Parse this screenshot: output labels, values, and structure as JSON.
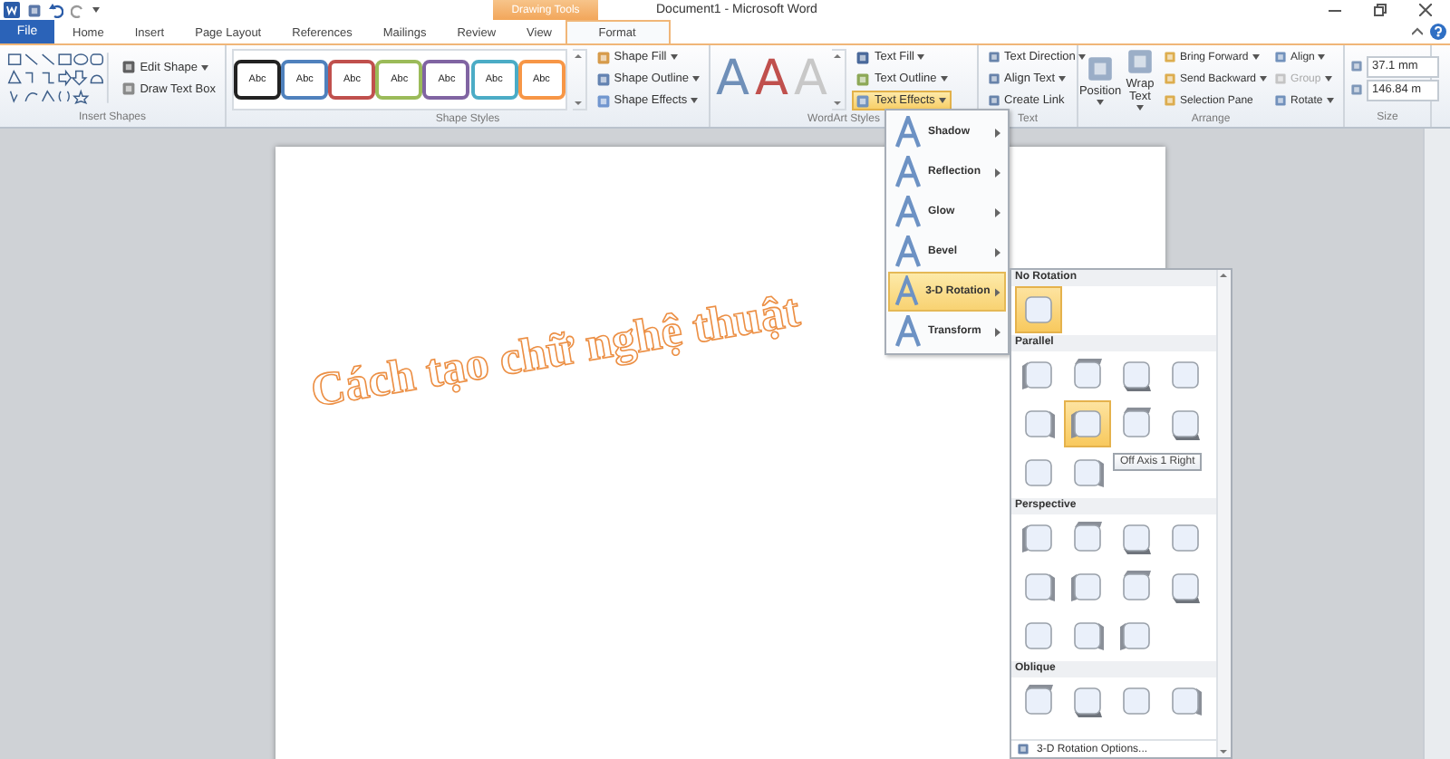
{
  "title": "Document1 - Microsoft Word",
  "context_label": "Drawing Tools",
  "file_tab": "File",
  "tabs": [
    {
      "label": "Home",
      "selected": false
    },
    {
      "label": "Insert",
      "selected": false
    },
    {
      "label": "Page Layout",
      "selected": false
    },
    {
      "label": "References",
      "selected": false
    },
    {
      "label": "Mailings",
      "selected": false
    },
    {
      "label": "Review",
      "selected": false
    },
    {
      "label": "View",
      "selected": false
    },
    {
      "label": "Format",
      "selected": true
    }
  ],
  "insert_shapes": {
    "label": "Insert Shapes",
    "buttons": [
      "Edit Shape",
      "Draw Text Box"
    ]
  },
  "shape_styles": {
    "label": "Shape Styles",
    "presets": [
      {
        "text": "Abc",
        "color": "#222222"
      },
      {
        "text": "Abc",
        "color": "#4f81bd"
      },
      {
        "text": "Abc",
        "color": "#c0504d"
      },
      {
        "text": "Abc",
        "color": "#9bbb59"
      },
      {
        "text": "Abc",
        "color": "#8064a2"
      },
      {
        "text": "Abc",
        "color": "#4bacc6"
      },
      {
        "text": "Abc",
        "color": "#f79646"
      }
    ],
    "buttons": [
      "Shape Fill",
      "Shape Outline",
      "Shape Effects"
    ]
  },
  "wordart_styles": {
    "label": "WordArt Styles",
    "presets": [
      {
        "text": "A",
        "color": "#6f8fb8"
      },
      {
        "text": "A",
        "color": "#c0504d"
      },
      {
        "text": "A",
        "color": "#c8c8c8"
      }
    ],
    "buttons": [
      {
        "label": "Text Fill",
        "selected": false
      },
      {
        "label": "Text Outline",
        "selected": false
      },
      {
        "label": "Text Effects",
        "selected": true
      }
    ]
  },
  "text_group": {
    "label": "Text",
    "buttons": [
      "Text Direction",
      "Align Text",
      "Create Link"
    ]
  },
  "arrange": {
    "label": "Arrange",
    "big_buttons": [
      "Position",
      "Wrap Text"
    ],
    "commands": [
      {
        "label": "Bring Forward",
        "disabled": false
      },
      {
        "label": "Send Backward",
        "disabled": false
      },
      {
        "label": "Selection Pane",
        "disabled": false
      },
      {
        "label": "Align",
        "disabled": false
      },
      {
        "label": "Group",
        "disabled": true
      },
      {
        "label": "Rotate",
        "disabled": false
      }
    ]
  },
  "size": {
    "label": "Size",
    "height": "37.1 mm",
    "width": "146.84 m"
  },
  "document": {
    "wordart": "Cách tạo chữ nghệ thuật"
  },
  "text_effects_menu": {
    "items": [
      {
        "label": "Shadow",
        "selected": false
      },
      {
        "label": "Reflection",
        "selected": false
      },
      {
        "label": "Glow",
        "selected": false
      },
      {
        "label": "Bevel",
        "selected": false
      },
      {
        "label": "3-D Rotation",
        "selected": true
      },
      {
        "label": "Transform",
        "selected": false
      }
    ]
  },
  "rotation_gallery": {
    "sections": [
      {
        "title": "No Rotation",
        "items": [
          {
            "selected": true
          }
        ]
      },
      {
        "title": "Parallel",
        "items": [
          {
            "selected": false
          },
          {
            "selected": false
          },
          {
            "selected": false
          },
          {
            "selected": false
          },
          {
            "selected": false
          },
          {
            "selected": true
          },
          {
            "selected": false
          },
          {
            "selected": false
          },
          {
            "selected": false
          },
          {
            "selected": false
          }
        ]
      },
      {
        "title": "Perspective",
        "items": [
          {
            "selected": false
          },
          {
            "selected": false
          },
          {
            "selected": false
          },
          {
            "selected": false
          },
          {
            "selected": false
          },
          {
            "selected": false
          },
          {
            "selected": false
          },
          {
            "selected": false
          },
          {
            "selected": false
          },
          {
            "selected": false
          },
          {
            "selected": false
          }
        ]
      },
      {
        "title": "Oblique",
        "items": [
          {
            "selected": false
          },
          {
            "selected": false
          },
          {
            "selected": false
          },
          {
            "selected": false
          }
        ]
      }
    ],
    "tooltip": "Off Axis 1 Right",
    "options_link": "3-D Rotation Options..."
  }
}
